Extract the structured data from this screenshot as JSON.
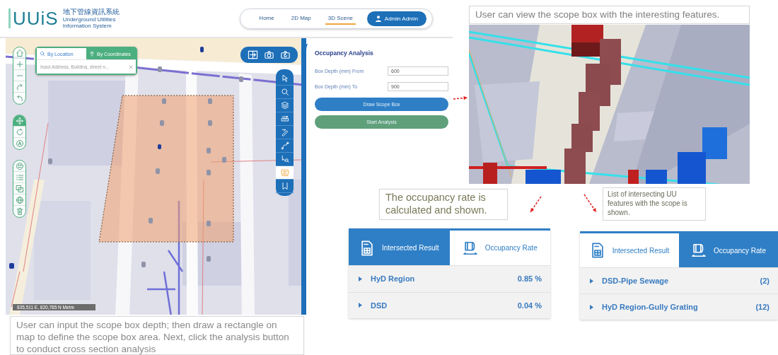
{
  "header": {
    "logo": {
      "mark": "UUiS",
      "name_zh": "地下管線資訊系統",
      "name_en_1": "Underground Utilities",
      "name_en_2": "Information System"
    },
    "nav": [
      {
        "label": "Home",
        "selected": false
      },
      {
        "label": "2D Map",
        "selected": false
      },
      {
        "label": "3D Scene",
        "selected": true
      }
    ],
    "user_button": "Admin Admin"
  },
  "map": {
    "search": {
      "tabs": [
        {
          "label": "By Location",
          "kind": "search",
          "selected": false
        },
        {
          "label": "By Coordinates",
          "kind": "pin",
          "selected": true
        }
      ],
      "placeholder": "Input Address, Building, street n..."
    },
    "toolbar_groups": [
      {
        "tools": [
          {
            "kind": "home",
            "selected": false
          },
          {
            "kind": "zoomin",
            "selected": false
          },
          {
            "kind": "zoomout",
            "selected": false
          },
          {
            "kind": "redo",
            "selected": false
          },
          {
            "kind": "undo",
            "selected": false
          }
        ]
      },
      {
        "tools": [
          {
            "kind": "pan",
            "selected": true
          },
          {
            "kind": "rotate",
            "selected": false
          },
          {
            "kind": "north",
            "selected": false
          }
        ]
      },
      {
        "tools": [
          {
            "kind": "basemap",
            "selected": false
          },
          {
            "kind": "legend",
            "selected": false
          },
          {
            "kind": "copy",
            "selected": false
          },
          {
            "kind": "globe",
            "selected": false
          },
          {
            "kind": "trash",
            "selected": false
          }
        ]
      }
    ],
    "view_tools": [
      {
        "kind": "swap"
      },
      {
        "kind": "camera"
      },
      {
        "kind": "camera2"
      }
    ],
    "side_tools": [
      {
        "kind": "select",
        "selected": false
      },
      {
        "kind": "search",
        "selected": false
      },
      {
        "kind": "layers",
        "selected": false
      },
      {
        "kind": "measure",
        "selected": false
      },
      {
        "kind": "draw",
        "selected": false
      },
      {
        "kind": "route",
        "selected": false
      },
      {
        "kind": "identify",
        "selected": false
      },
      {
        "kind": "scope",
        "selected": true
      },
      {
        "kind": "bookmark",
        "selected": false
      }
    ],
    "coordinates": "835,511 E, 820,785 N Metre",
    "caption": "User can input the scope box depth; then draw a rectangle on map to define the scope box area. Next, click the analysis button to conduct cross section analysis"
  },
  "panel": {
    "title": "Occupancy Analysis",
    "fields": [
      {
        "label": "Box Depth (mm) From",
        "value": "600"
      },
      {
        "label": "Box Depth (mm) To",
        "value": "900"
      }
    ],
    "buttons": [
      {
        "label": "Draw Scope Box",
        "kind": "primary"
      },
      {
        "label": "Start Analysis",
        "kind": "success"
      }
    ]
  },
  "scene": {
    "caption": "User can view the scope box with the interesting features."
  },
  "results": [
    {
      "note": "The occupancy rate is calculated and shown.",
      "tabs": [
        {
          "label": "Intersected Result",
          "kind": "table",
          "selected": false
        },
        {
          "label": "Occupancy Rate",
          "kind": "rate",
          "selected": true
        }
      ],
      "rows": [
        {
          "name": "HyD Region",
          "value": "0.85 %"
        },
        {
          "name": "DSD",
          "value": "0.04 %"
        }
      ]
    },
    {
      "note": "List of intersecting UU features with the scope is shown.",
      "tabs": [
        {
          "label": "Intersected Result",
          "kind": "table",
          "selected": true
        },
        {
          "label": "Occupancy Rate",
          "kind": "rate",
          "selected": false
        }
      ],
      "rows": [
        {
          "name": "DSD-Pipe Sewage",
          "value": "(2)"
        },
        {
          "name": "HyD Region-Gully Grating",
          "value": "(12)"
        }
      ]
    }
  ]
}
